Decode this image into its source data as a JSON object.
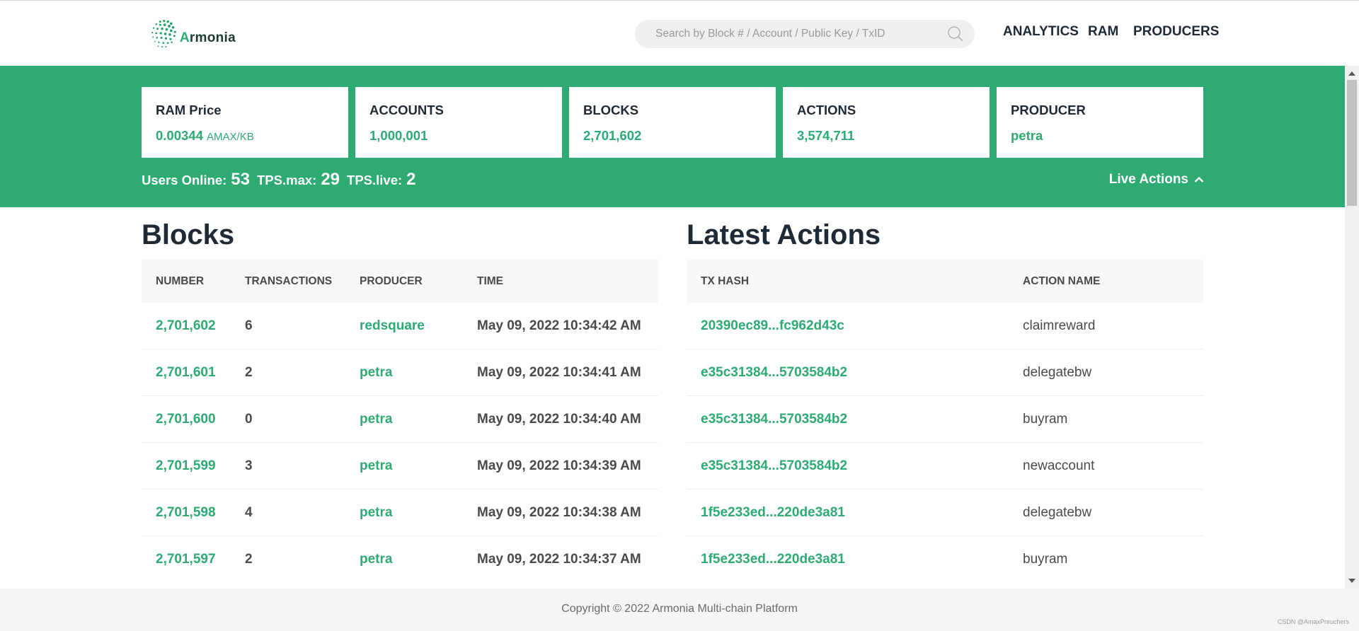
{
  "header": {
    "logo_text": "rmonia",
    "logo_initial": "A",
    "search": {
      "placeholder": "Search by Block # / Account / Public Key / TxID"
    },
    "nav": [
      {
        "label": "ANALYTICS"
      },
      {
        "label": "RAM"
      },
      {
        "label": "PRODUCERS"
      }
    ]
  },
  "stats_cards": [
    {
      "title": "RAM Price",
      "value": "0.00344",
      "unit": "AMAX/KB"
    },
    {
      "title": "ACCOUNTS",
      "value": "1,000,001"
    },
    {
      "title": "BLOCKS",
      "value": "2,701,602"
    },
    {
      "title": "ACTIONS",
      "value": "3,574,711"
    },
    {
      "title": "PRODUCER",
      "value": "petra"
    }
  ],
  "live_stats": {
    "users_online_label": "Users Online:",
    "users_online": "53",
    "tps_max_label": "TPS.max:",
    "tps_max": "29",
    "tps_live_label": "TPS.live:",
    "tps_live": "2",
    "live_actions_label": "Live Actions"
  },
  "blocks": {
    "title": "Blocks",
    "headers": [
      "NUMBER",
      "TRANSACTIONS",
      "PRODUCER",
      "TIME"
    ],
    "rows": [
      {
        "number": "2,701,602",
        "transactions": "6",
        "producer": "redsquare",
        "time": "May 09, 2022 10:34:42 AM"
      },
      {
        "number": "2,701,601",
        "transactions": "2",
        "producer": "petra",
        "time": "May 09, 2022 10:34:41 AM"
      },
      {
        "number": "2,701,600",
        "transactions": "0",
        "producer": "petra",
        "time": "May 09, 2022 10:34:40 AM"
      },
      {
        "number": "2,701,599",
        "transactions": "3",
        "producer": "petra",
        "time": "May 09, 2022 10:34:39 AM"
      },
      {
        "number": "2,701,598",
        "transactions": "4",
        "producer": "petra",
        "time": "May 09, 2022 10:34:38 AM"
      },
      {
        "number": "2,701,597",
        "transactions": "2",
        "producer": "petra",
        "time": "May 09, 2022 10:34:37 AM"
      }
    ]
  },
  "actions": {
    "title": "Latest Actions",
    "headers": [
      "TX HASH",
      "ACTION NAME"
    ],
    "rows": [
      {
        "hash": "20390ec89...fc962d43c",
        "action": "claimreward"
      },
      {
        "hash": "e35c31384...5703584b2",
        "action": "delegatebw"
      },
      {
        "hash": "e35c31384...5703584b2",
        "action": "buyram"
      },
      {
        "hash": "e35c31384...5703584b2",
        "action": "newaccount"
      },
      {
        "hash": "1f5e233ed...220de3a81",
        "action": "delegatebw"
      },
      {
        "hash": "1f5e233ed...220de3a81",
        "action": "buyram"
      }
    ]
  },
  "footer": {
    "copyright": "Copyright © 2022 Armonia Multi-chain Platform",
    "watermark": "CSDN @AmaxPreuchers"
  },
  "colors": {
    "brand_green": "#2eaa73",
    "text_dark": "#1f2a37",
    "header_bg": "#f7f8f9"
  }
}
